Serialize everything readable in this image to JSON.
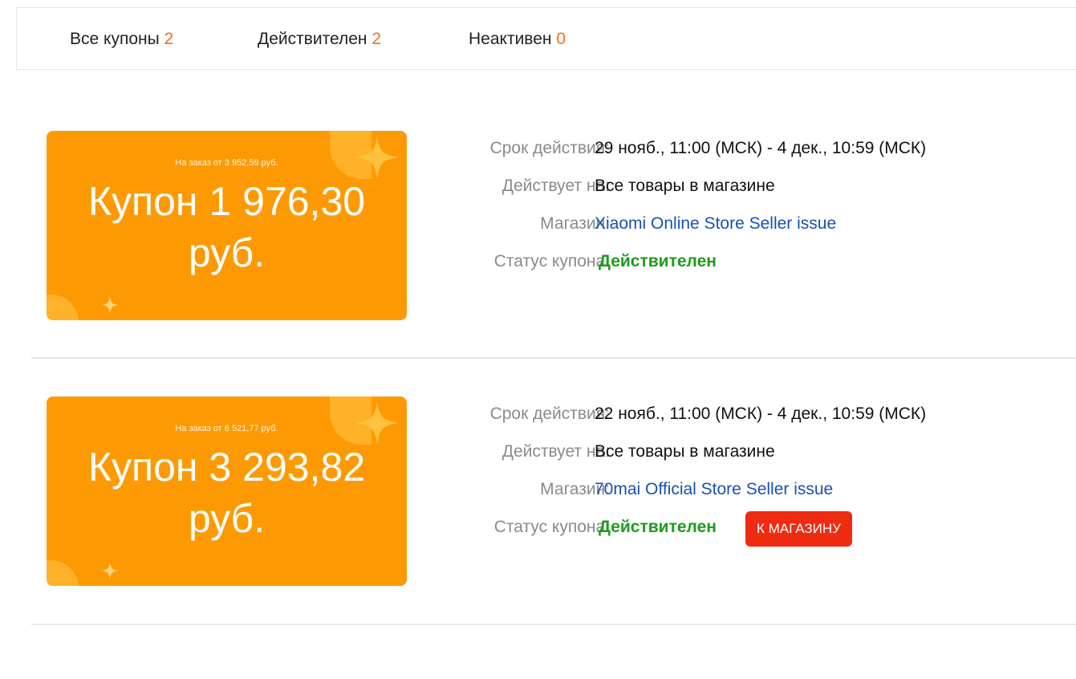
{
  "tabs": {
    "all": {
      "label": "Все купоны",
      "count": "2"
    },
    "valid": {
      "label": "Действителен",
      "count": "2"
    },
    "inactive": {
      "label": "Неактивен",
      "count": "0"
    }
  },
  "labels": {
    "validity": "Срок действия:",
    "applies_to": "Действует на:",
    "store": "Магазин:",
    "status": "Статус купона:"
  },
  "coupons": [
    {
      "min_order": "На заказ от 3 952,59 руб.",
      "amount_line1": "Купон 1 976,30",
      "amount_line2": "руб.",
      "validity": "29 нояб., 11:00 (МСК) - 4 дек., 10:59 (МСК)",
      "applies_to": "Все товары в магазине",
      "store": "Xiaomi Online Store Seller issue",
      "status": "Действителен"
    },
    {
      "min_order": "На заказ от 6 521,77 руб.",
      "amount_line1": "Купон 3 293,82",
      "amount_line2": "руб.",
      "validity": "22 нояб., 11:00 (МСК) - 4 дек., 10:59 (МСК)",
      "applies_to": "Все товары в магазине",
      "store": "70mai Official Store Seller issue",
      "status": "Действителен",
      "button": "К МАГАЗИНУ"
    }
  ],
  "colors": {
    "coupon_bg": "#fd9a03",
    "count_accent": "#f76b1c",
    "status_green": "#1e9b1e",
    "link_blue": "#1b4fb4",
    "button_red": "#ef2b12"
  },
  "icons": [
    "sparkle-star-icon"
  ]
}
